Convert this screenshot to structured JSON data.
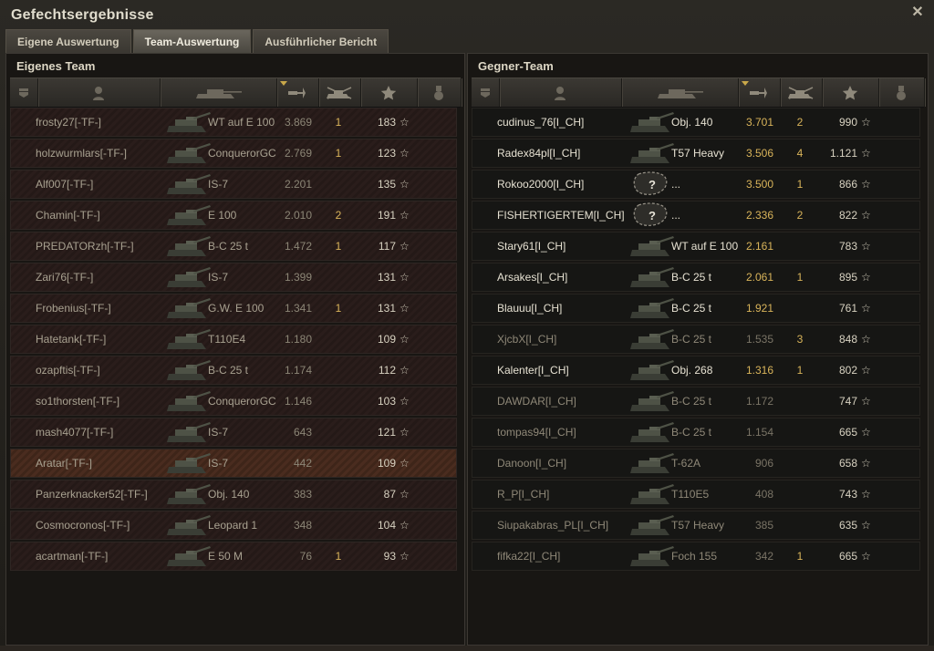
{
  "window": {
    "title": "Gefechtsergebnisse",
    "close_icon": "close-icon"
  },
  "tabs": [
    {
      "label": "Eigene Auswertung",
      "active": false
    },
    {
      "label": "Team-Auswertung",
      "active": true
    },
    {
      "label": "Ausführlicher Bericht",
      "active": false
    }
  ],
  "own_team": {
    "title": "Eigenes Team",
    "columns": [
      "squad-icon",
      "player-icon",
      "tank-icon",
      "damage-icon",
      "kills-icon",
      "xp-star-icon",
      "medal-icon"
    ],
    "sorted_column": "damage-icon",
    "rows": [
      {
        "player": "frosty27[-TF-]",
        "tank": "WT auf E 100",
        "damage": "3.869",
        "kills": "1",
        "xp": "183",
        "highlight": false
      },
      {
        "player": "holzwurmlars[-TF-]",
        "tank": "ConquerorGC",
        "damage": "2.769",
        "kills": "1",
        "xp": "123",
        "highlight": false
      },
      {
        "player": "Alf007[-TF-]",
        "tank": "IS-7",
        "damage": "2.201",
        "kills": "",
        "xp": "135",
        "highlight": false
      },
      {
        "player": "Chamin[-TF-]",
        "tank": "E 100",
        "damage": "2.010",
        "kills": "2",
        "xp": "191",
        "highlight": false
      },
      {
        "player": "PREDATORzh[-TF-]",
        "tank": "B-C 25 t",
        "damage": "1.472",
        "kills": "1",
        "xp": "117",
        "highlight": false
      },
      {
        "player": "Zari76[-TF-]",
        "tank": "IS-7",
        "damage": "1.399",
        "kills": "",
        "xp": "131",
        "highlight": false
      },
      {
        "player": "Frobenius[-TF-]",
        "tank": "G.W. E 100",
        "damage": "1.341",
        "kills": "1",
        "xp": "131",
        "highlight": false
      },
      {
        "player": "Hatetank[-TF-]",
        "tank": "T110E4",
        "damage": "1.180",
        "kills": "",
        "xp": "109",
        "highlight": false
      },
      {
        "player": "ozapftis[-TF-]",
        "tank": "B-C 25 t",
        "damage": "1.174",
        "kills": "",
        "xp": "112",
        "highlight": false
      },
      {
        "player": "so1thorsten[-TF-]",
        "tank": "ConquerorGC",
        "damage": "1.146",
        "kills": "",
        "xp": "103",
        "highlight": false
      },
      {
        "player": "mash4077[-TF-]",
        "tank": "IS-7",
        "damage": "643",
        "kills": "",
        "xp": "121",
        "highlight": false
      },
      {
        "player": "Aratar[-TF-]",
        "tank": "IS-7",
        "damage": "442",
        "kills": "",
        "xp": "109",
        "highlight": true
      },
      {
        "player": "Panzerknacker52[-TF-]",
        "tank": "Obj. 140",
        "damage": "383",
        "kills": "",
        "xp": "87",
        "highlight": false
      },
      {
        "player": "Cosmocronos[-TF-]",
        "tank": "Leopard 1",
        "damage": "348",
        "kills": "",
        "xp": "104",
        "highlight": false
      },
      {
        "player": "acartman[-TF-]",
        "tank": "E 50 M",
        "damage": "76",
        "kills": "1",
        "xp": "93",
        "highlight": false
      }
    ]
  },
  "enemy_team": {
    "title": "Gegner-Team",
    "columns": [
      "squad-icon",
      "player-icon",
      "tank-icon",
      "damage-icon",
      "kills-icon",
      "xp-star-icon",
      "medal-icon"
    ],
    "sorted_column": "damage-icon",
    "rows": [
      {
        "player": "cudinus_76[I_CH]",
        "tank": "Obj. 140",
        "damage": "3.701",
        "kills": "2",
        "xp": "990",
        "dim": false,
        "unknown": false
      },
      {
        "player": "Radex84pl[I_CH]",
        "tank": "T57 Heavy",
        "damage": "3.506",
        "kills": "4",
        "xp": "1.121",
        "dim": false,
        "unknown": false
      },
      {
        "player": "Rokoo2000[I_CH]",
        "tank": "...",
        "damage": "3.500",
        "kills": "1",
        "xp": "866",
        "dim": false,
        "unknown": true
      },
      {
        "player": "FISHERTIGERTEM[I_CH]",
        "tank": "...",
        "damage": "2.336",
        "kills": "2",
        "xp": "822",
        "dim": false,
        "unknown": true
      },
      {
        "player": "Stary61[I_CH]",
        "tank": "WT auf E 100",
        "damage": "2.161",
        "kills": "",
        "xp": "783",
        "dim": false,
        "unknown": false
      },
      {
        "player": "Arsakes[I_CH]",
        "tank": "B-C 25 t",
        "damage": "2.061",
        "kills": "1",
        "xp": "895",
        "dim": false,
        "unknown": false
      },
      {
        "player": "Blauuu[I_CH]",
        "tank": "B-C 25 t",
        "damage": "1.921",
        "kills": "",
        "xp": "761",
        "dim": false,
        "unknown": false
      },
      {
        "player": "XjcbX[I_CH]",
        "tank": "B-C 25 t",
        "damage": "1.535",
        "kills": "3",
        "xp": "848",
        "dim": true,
        "unknown": false
      },
      {
        "player": "Kalenter[I_CH]",
        "tank": "Obj. 268",
        "damage": "1.316",
        "kills": "1",
        "xp": "802",
        "dim": false,
        "unknown": false
      },
      {
        "player": "DAWDAR[I_CH]",
        "tank": "B-C 25 t",
        "damage": "1.172",
        "kills": "",
        "xp": "747",
        "dim": true,
        "unknown": false
      },
      {
        "player": "tompas94[I_CH]",
        "tank": "B-C 25 t",
        "damage": "1.154",
        "kills": "",
        "xp": "665",
        "dim": true,
        "unknown": false
      },
      {
        "player": "Danoon[I_CH]",
        "tank": "T-62A",
        "damage": "906",
        "kills": "",
        "xp": "658",
        "dim": true,
        "unknown": false
      },
      {
        "player": "R_P[I_CH]",
        "tank": "T110E5",
        "damage": "408",
        "kills": "",
        "xp": "743",
        "dim": true,
        "unknown": false
      },
      {
        "player": "Siupakabras_PL[I_CH]",
        "tank": "T57 Heavy",
        "damage": "385",
        "kills": "",
        "xp": "635",
        "dim": true,
        "unknown": false
      },
      {
        "player": "fifka22[I_CH]",
        "tank": "Foch 155",
        "damage": "342",
        "kills": "1",
        "xp": "665",
        "dim": true,
        "unknown": false
      }
    ]
  },
  "colors": {
    "accent": "#d9b45a",
    "background": "#1a1814"
  }
}
